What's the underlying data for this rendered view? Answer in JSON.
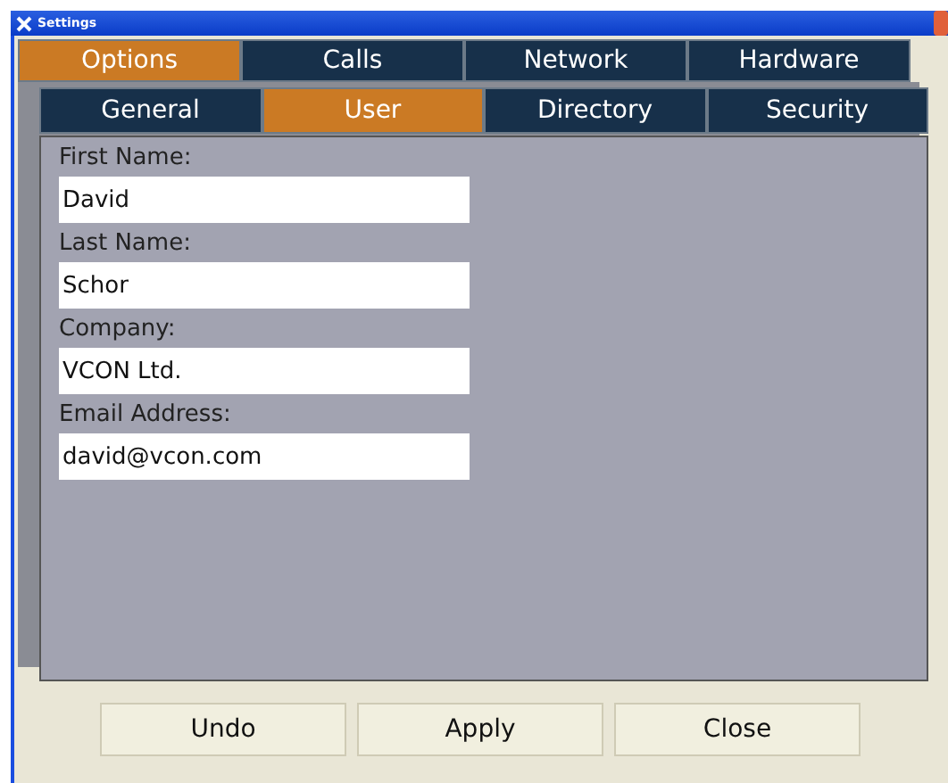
{
  "window": {
    "title": "Settings"
  },
  "tabs": [
    {
      "label": "Options",
      "selected": true
    },
    {
      "label": "Calls",
      "selected": false
    },
    {
      "label": "Network",
      "selected": false
    },
    {
      "label": "Hardware",
      "selected": false
    }
  ],
  "subtabs": [
    {
      "label": "General",
      "selected": false
    },
    {
      "label": "User",
      "selected": true
    },
    {
      "label": "Directory",
      "selected": false
    },
    {
      "label": "Security",
      "selected": false
    }
  ],
  "fields": [
    {
      "label": "First Name:",
      "value": "David"
    },
    {
      "label": "Last Name:",
      "value": "Schor"
    },
    {
      "label": "Company:",
      "value": "VCON Ltd."
    },
    {
      "label": "Email Address:",
      "value": "david@vcon.com"
    }
  ],
  "buttons": [
    "Undo",
    "Apply",
    "Close"
  ]
}
